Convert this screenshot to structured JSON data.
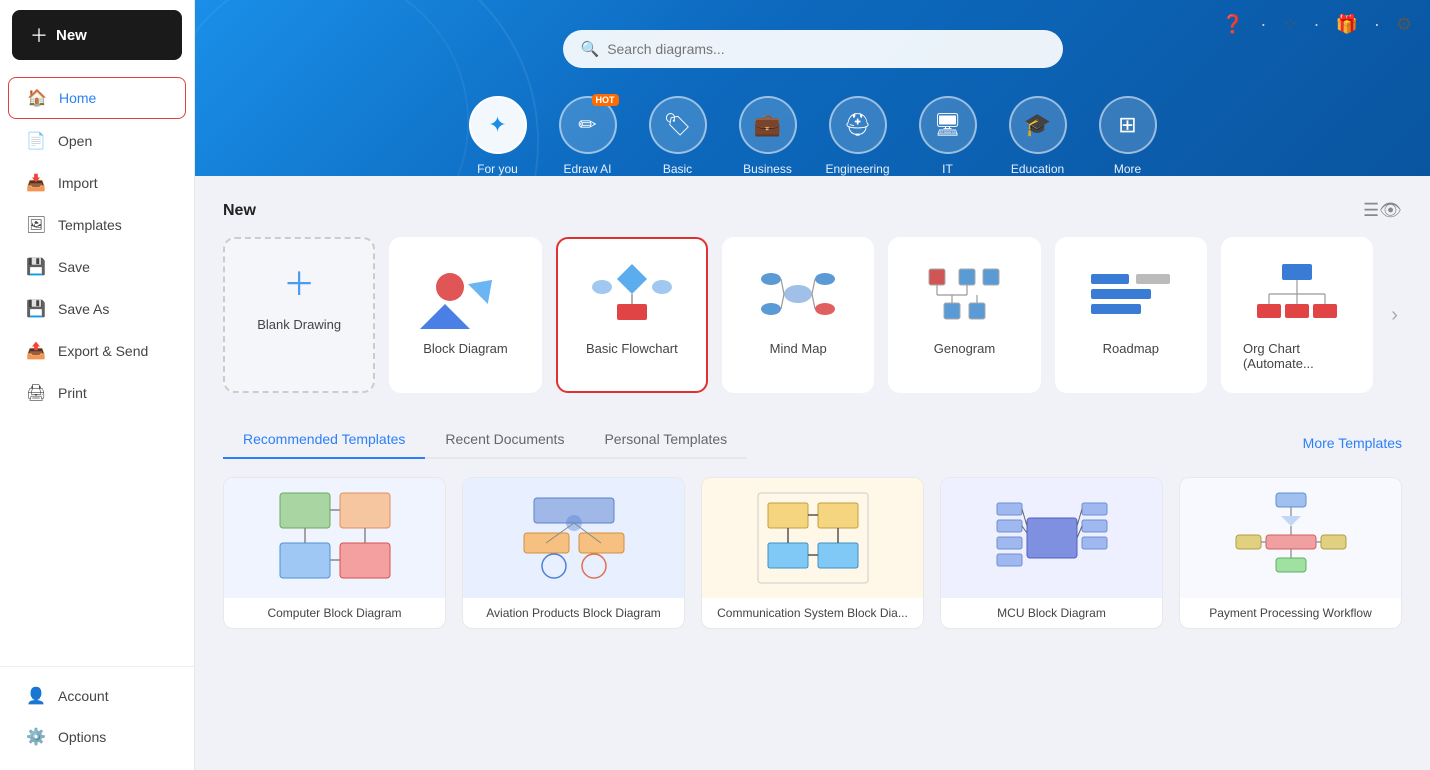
{
  "sidebar": {
    "new_label": "New",
    "items": [
      {
        "id": "home",
        "label": "Home",
        "icon": "🏠",
        "active": true
      },
      {
        "id": "open",
        "label": "Open",
        "icon": "📄"
      },
      {
        "id": "import",
        "label": "Import",
        "icon": "📥"
      },
      {
        "id": "templates",
        "label": "Templates",
        "icon": "🖼"
      },
      {
        "id": "save",
        "label": "Save",
        "icon": "💾"
      },
      {
        "id": "save-as",
        "label": "Save As",
        "icon": "💾"
      },
      {
        "id": "export-send",
        "label": "Export & Send",
        "icon": "📤"
      },
      {
        "id": "print",
        "label": "Print",
        "icon": "🖨"
      }
    ],
    "bottom": [
      {
        "id": "account",
        "label": "Account",
        "icon": "👤"
      },
      {
        "id": "options",
        "label": "Options",
        "icon": "⚙️"
      }
    ]
  },
  "topbar": {
    "icons": [
      "help",
      "apps",
      "gift",
      "settings"
    ]
  },
  "hero": {
    "search_placeholder": "Search diagrams...",
    "categories": [
      {
        "id": "for-you",
        "label": "For you",
        "icon": "✦",
        "active": true
      },
      {
        "id": "edraw-ai",
        "label": "Edraw AI",
        "icon": "✏",
        "badge": "HOT"
      },
      {
        "id": "basic",
        "label": "Basic",
        "icon": "🏷"
      },
      {
        "id": "business",
        "label": "Business",
        "icon": "💼"
      },
      {
        "id": "engineering",
        "label": "Engineering",
        "icon": "⛑"
      },
      {
        "id": "it",
        "label": "IT",
        "icon": "🖥"
      },
      {
        "id": "education",
        "label": "Education",
        "icon": "🎓"
      },
      {
        "id": "more",
        "label": "More",
        "icon": "⊞"
      }
    ]
  },
  "new_section": {
    "title": "New",
    "cards": [
      {
        "id": "blank",
        "label": "Blank Drawing",
        "type": "blank"
      },
      {
        "id": "block-diagram",
        "label": "Block Diagram",
        "type": "block"
      },
      {
        "id": "basic-flowchart",
        "label": "Basic Flowchart",
        "type": "flowchart",
        "selected": true
      },
      {
        "id": "mind-map",
        "label": "Mind Map",
        "type": "mindmap"
      },
      {
        "id": "genogram",
        "label": "Genogram",
        "type": "genogram"
      },
      {
        "id": "roadmap",
        "label": "Roadmap",
        "type": "roadmap"
      },
      {
        "id": "org-chart",
        "label": "Org Chart (Automate...",
        "type": "orgchart"
      }
    ]
  },
  "templates_section": {
    "tabs": [
      {
        "id": "recommended",
        "label": "Recommended Templates",
        "active": true
      },
      {
        "id": "recent",
        "label": "Recent Documents"
      },
      {
        "id": "personal",
        "label": "Personal Templates"
      }
    ],
    "more_label": "More Templates",
    "cards": [
      {
        "id": "computer-block",
        "label": "Computer Block Diagram"
      },
      {
        "id": "aviation-products",
        "label": "Aviation Products Block Diagram"
      },
      {
        "id": "communication-system",
        "label": "Communication System Block Dia..."
      },
      {
        "id": "mcu-block",
        "label": "MCU Block Diagram"
      },
      {
        "id": "payment-workflow",
        "label": "Payment Processing Workflow"
      }
    ]
  }
}
